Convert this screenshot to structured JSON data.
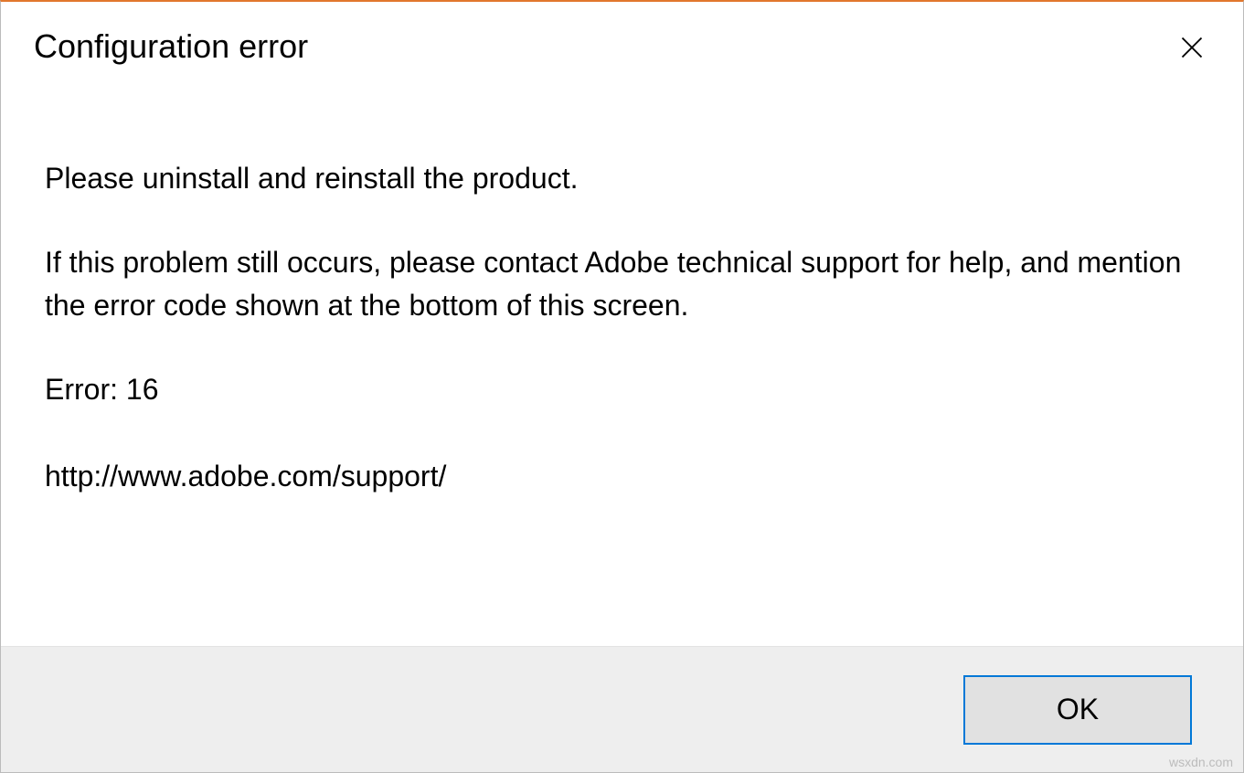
{
  "dialog": {
    "title": "Configuration error",
    "message_line1": "Please uninstall and reinstall the product.",
    "message_line2": "If this problem still occurs, please contact Adobe technical support for help, and mention the error code shown at the bottom of this screen.",
    "error_code": "Error: 16",
    "support_url": "http://www.adobe.com/support/",
    "ok_label": "OK"
  },
  "watermark": {
    "small": "wsxdn.com"
  }
}
